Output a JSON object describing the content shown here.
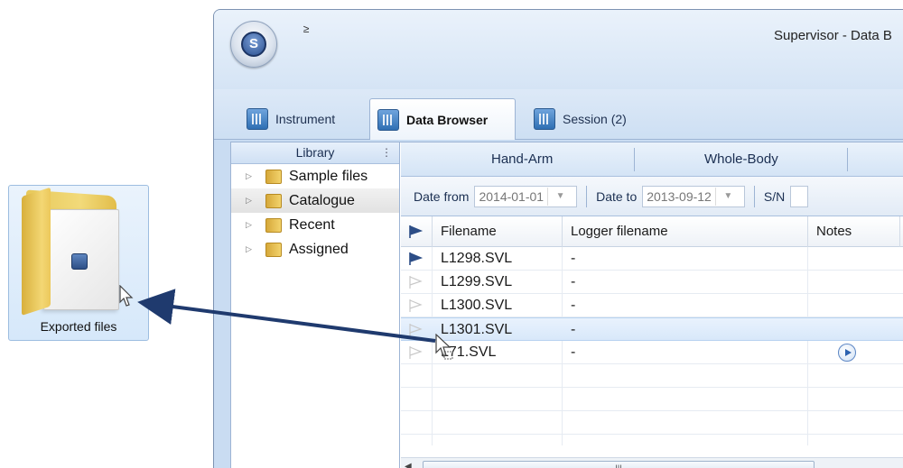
{
  "desktop": {
    "folder_label": "Exported files"
  },
  "window": {
    "title": "Supervisor - Data B",
    "qat_glyph": "≥",
    "orb_letter": "S"
  },
  "ribbon": {
    "tabs": [
      {
        "label": "Instrument",
        "icon": "instrument-icon",
        "active": false
      },
      {
        "label": "Data Browser",
        "icon": "data-browser-icon",
        "active": true
      },
      {
        "label": "Session (2)",
        "icon": "session-icon",
        "active": false
      }
    ]
  },
  "library": {
    "header": "Library",
    "items": [
      {
        "label": "Sample files",
        "icon": "folder-icon"
      },
      {
        "label": "Catalogue",
        "icon": "folder-icon"
      },
      {
        "label": "Recent",
        "icon": "recent-folder-icon"
      },
      {
        "label": "Assigned",
        "icon": "assigned-folder-icon"
      }
    ]
  },
  "categories": [
    "Hand-Arm",
    "Whole-Body"
  ],
  "filters": {
    "date_from_label": "Date from",
    "date_from_value": "2014-01-01",
    "date_to_label": "Date to",
    "date_to_value": "2013-09-12",
    "sn_label": "S/N"
  },
  "grid": {
    "columns": [
      "Filename",
      "Logger filename",
      "Notes"
    ],
    "rows": [
      {
        "filename": "L1298.SVL",
        "logger_filename": "-",
        "flagged": true,
        "note_icon": false
      },
      {
        "filename": "L1299.SVL",
        "logger_filename": "-",
        "flagged": false,
        "note_icon": false
      },
      {
        "filename": "L1300.SVL",
        "logger_filename": "-",
        "flagged": false,
        "note_icon": false
      },
      {
        "filename": "L1301.SVL",
        "logger_filename": "-",
        "flagged": false,
        "note_icon": false
      },
      {
        "filename": "L71.SVL",
        "logger_filename": "-",
        "flagged": false,
        "note_icon": true
      }
    ],
    "scroll_thumb_glyph": "III"
  },
  "colors": {
    "accent": "#1f3a6e",
    "flag": "#2c4d86"
  }
}
